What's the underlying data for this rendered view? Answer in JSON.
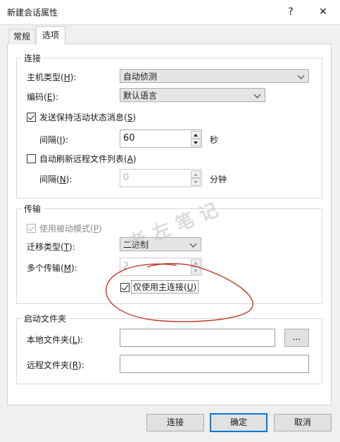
{
  "window": {
    "title": "新建会话属性",
    "help_glyph": "?",
    "close_glyph": "✕"
  },
  "tabs": {
    "general": "常规",
    "options": "选项"
  },
  "connection": {
    "legend": "连接",
    "host_type_label": "主机类型(",
    "host_type_key": "H",
    "host_type_end": "):",
    "host_type_value": "自动侦测",
    "encoding_label": "编码(",
    "encoding_key": "E",
    "encoding_end": "):",
    "encoding_value": "默认语言",
    "keepalive_label": "发送保持活动状态消息(",
    "keepalive_key": "S",
    "keepalive_end": ")",
    "keepalive_checked": true,
    "interval1_label": "间隔(",
    "interval1_key": "I",
    "interval1_end": "):",
    "interval1_value": "60",
    "interval1_unit": "秒",
    "refresh_label": "自动刷新远程文件列表(",
    "refresh_key": "A",
    "refresh_end": ")",
    "refresh_checked": false,
    "interval2_label": "间隔(",
    "interval2_key": "N",
    "interval2_end": "):",
    "interval2_value": "0",
    "interval2_unit": "分钟"
  },
  "transfer": {
    "legend": "传输",
    "passive_label": "使用被动模式(",
    "passive_key": "P",
    "passive_end": ")",
    "passive_checked": true,
    "migrate_label": "迁移类型(",
    "migrate_key": "T",
    "migrate_end": "):",
    "migrate_value": "二进制",
    "multi_label": "多个传输(",
    "multi_key": "M",
    "multi_end": "):",
    "multi_value": "2",
    "main_conn_label": "仅使用主连接(",
    "main_conn_key": "U",
    "main_conn_end": ")",
    "main_conn_checked": true
  },
  "startup_folder": {
    "legend": "启动文件夹",
    "local_label": "本地文件夹(",
    "local_key": "L",
    "local_end": "):",
    "local_value": "",
    "browse_label": "...",
    "remote_label": "远程文件夹(",
    "remote_key": "R",
    "remote_end": "):",
    "remote_value": ""
  },
  "buttons": {
    "connect": "连接",
    "ok": "确定",
    "cancel": "取消"
  },
  "watermark": "老左笔记",
  "colors": {
    "accent": "#0078d7",
    "annotation": "#c0392b"
  }
}
